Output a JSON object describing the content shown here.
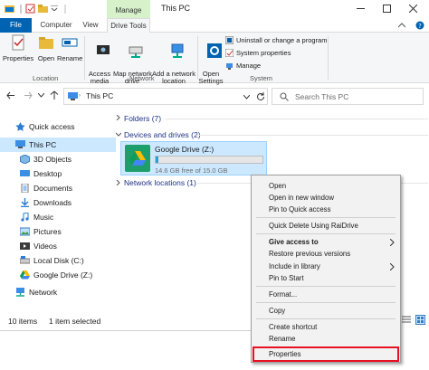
{
  "window": {
    "title": "This PC"
  },
  "tabs": {
    "file": "File",
    "computer": "Computer",
    "view": "View",
    "manage": "Manage",
    "drive_tools": "Drive Tools"
  },
  "ribbon": {
    "location": {
      "label": "Location",
      "properties": "Properties",
      "open": "Open",
      "rename": "Rename"
    },
    "network": {
      "label": "Network",
      "access_media": "Access\nmedia",
      "map_drive": "Map network\ndrive",
      "add_location": "Add a network\nlocation"
    },
    "system": {
      "label": "System",
      "open_settings": "Open\nSettings",
      "uninstall": "Uninstall or change a program",
      "system_properties": "System properties",
      "manage": "Manage"
    }
  },
  "address": {
    "path": "This PC",
    "search_placeholder": "Search This PC"
  },
  "nav": {
    "quick_access": "Quick access",
    "this_pc": "This PC",
    "objects_3d": "3D Objects",
    "desktop": "Desktop",
    "documents": "Documents",
    "downloads": "Downloads",
    "music": "Music",
    "pictures": "Pictures",
    "videos": "Videos",
    "local_disk": "Local Disk (C:)",
    "google_drive": "Google Drive (Z:)",
    "network": "Network"
  },
  "content": {
    "folders": "Folders (7)",
    "devices": "Devices and drives (2)",
    "drive": {
      "name": "Google Drive (Z:)",
      "free": "14.6 GB free of 15.0 GB",
      "used_fraction": 0.027
    },
    "network_locations": "Network locations (1)"
  },
  "status": {
    "items": "10 items",
    "selected": "1 item selected"
  },
  "context_menu": {
    "open": "Open",
    "open_new_window": "Open in new window",
    "pin_quick": "Pin to Quick access",
    "quick_delete": "Quick Delete Using RaiDrive",
    "give_access": "Give access to",
    "restore": "Restore previous versions",
    "include_library": "Include in library",
    "pin_start": "Pin to Start",
    "format": "Format...",
    "copy": "Copy",
    "create_shortcut": "Create shortcut",
    "rename": "Rename",
    "properties": "Properties"
  },
  "colors": {
    "accent": "#0063b1",
    "manage_tab": "#d7f2cb",
    "selection": "#cce8ff",
    "highlight_border": "#e81123"
  }
}
